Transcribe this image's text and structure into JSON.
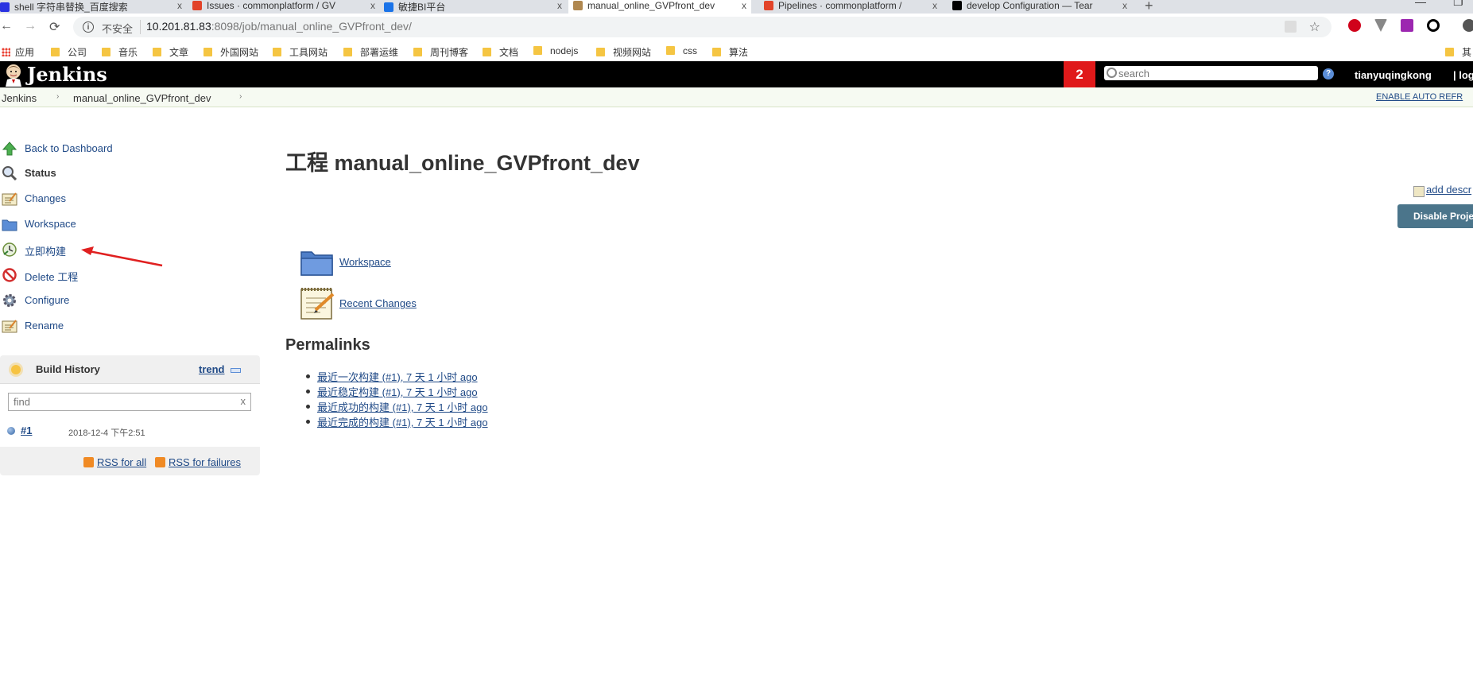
{
  "browser": {
    "tabs": [
      {
        "title": "shell 字符串替换_百度搜索",
        "icon_color": "#2932e1"
      },
      {
        "title": "Issues · commonplatform / GV",
        "icon_color": "#e24329"
      },
      {
        "title": "敏捷BI平台",
        "icon_color": "#1a73e8"
      },
      {
        "title": "manual_online_GVPfront_dev",
        "icon_color": "#b08850"
      },
      {
        "title": "Pipelines · commonplatform /",
        "icon_color": "#e24329"
      },
      {
        "title": "develop Configuration — Tear",
        "icon_color": "#000000"
      }
    ],
    "tab_close": "x",
    "new_tab": "+",
    "security_label": "不安全",
    "url_host": "10.201.81.83",
    "url_rest": ":8098/job/manual_online_GVPfront_dev/",
    "bookmarks": [
      "应用",
      "公司",
      "音乐",
      "文章",
      "外国网站",
      "工具网站",
      "部署运维",
      "周刊博客",
      "文档",
      "nodejs",
      "视频网站",
      "css",
      "算法"
    ],
    "bookmarks_overflow": "其"
  },
  "header": {
    "title": "Jenkins",
    "notification_count": "2",
    "search_placeholder": "search",
    "help": "?",
    "user": "tianyuqingkong",
    "logout": "| log"
  },
  "breadcrumbs": {
    "items": [
      "Jenkins",
      "manual_online_GVPfront_dev"
    ],
    "separator": "›",
    "auto_refresh": "ENABLE AUTO REFR"
  },
  "sidebar": {
    "items": [
      {
        "label": "Back to Dashboard",
        "icon": "up-arrow-icon"
      },
      {
        "label": "Status",
        "icon": "magnifier-icon"
      },
      {
        "label": "Changes",
        "icon": "notepad-icon"
      },
      {
        "label": "Workspace",
        "icon": "folder-icon"
      },
      {
        "label": "立即构建",
        "icon": "build-clock-icon"
      },
      {
        "label": "Delete 工程",
        "icon": "no-entry-icon"
      },
      {
        "label": "Configure",
        "icon": "gear-icon"
      },
      {
        "label": "Rename",
        "icon": "notepad-icon"
      }
    ]
  },
  "build_history": {
    "title": "Build History",
    "trend": "trend",
    "find_placeholder": "find",
    "clear": "x",
    "builds": [
      {
        "number": "#1",
        "date": "2018-12-4 下午2:51"
      }
    ],
    "rss_all": "RSS for all",
    "rss_failures": "RSS for failures"
  },
  "main": {
    "title": "工程 manual_online_GVPfront_dev",
    "add_description": "add descr",
    "disable_button": "Disable Proje",
    "links": [
      "Workspace",
      "Recent Changes"
    ],
    "permalinks_heading": "Permalinks",
    "permalinks": [
      "最近一次构建 (#1), 7 天 1 小时 ago",
      "最近稳定构建 (#1), 7 天 1 小时 ago",
      "最近成功的构建 (#1), 7 天 1 小时 ago",
      "最近完成的构建 (#1), 7 天 1 小时 ago"
    ]
  },
  "colors": {
    "header_bg": "#000000",
    "badge": "#e0191a",
    "link": "#204a87",
    "annotation_arrow": "#e02020",
    "disable_btn": "#4b758b"
  }
}
